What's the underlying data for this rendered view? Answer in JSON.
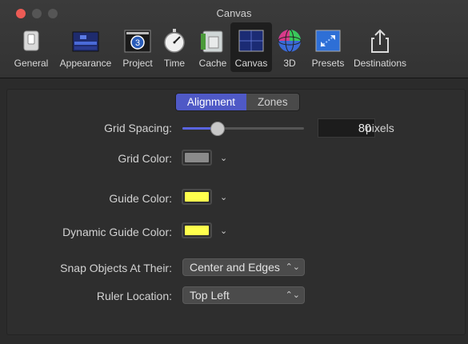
{
  "window": {
    "title": "Canvas"
  },
  "toolbar": {
    "items": [
      {
        "label": "General",
        "icon": "switch-icon"
      },
      {
        "label": "Appearance",
        "icon": "appearance-icon"
      },
      {
        "label": "Project",
        "icon": "project-icon"
      },
      {
        "label": "Time",
        "icon": "stopwatch-icon"
      },
      {
        "label": "Cache",
        "icon": "cache-icon"
      },
      {
        "label": "Canvas",
        "icon": "canvas-icon"
      },
      {
        "label": "3D",
        "icon": "sphere-icon"
      },
      {
        "label": "Presets",
        "icon": "presets-icon"
      },
      {
        "label": "Destinations",
        "icon": "share-icon"
      }
    ],
    "selected": "Canvas"
  },
  "segmented": {
    "alignment_label": "Alignment",
    "zones_label": "Zones",
    "active": "Alignment"
  },
  "grid_spacing": {
    "label": "Grid Spacing:",
    "value": "80",
    "unit": "pixels",
    "slider_fraction": 0.28
  },
  "grid_color": {
    "label": "Grid Color:",
    "color": "#8a8a8a"
  },
  "guide_color": {
    "label": "Guide Color:",
    "color": "#ffff4d"
  },
  "dynamic_guide_color": {
    "label": "Dynamic Guide Color:",
    "color": "#ffff4d"
  },
  "snap_objects": {
    "label": "Snap Objects At Their:",
    "value": "Center and Edges"
  },
  "ruler_location": {
    "label": "Ruler Location:",
    "value": "Top Left"
  },
  "colors": {
    "accent": "#4f59c6",
    "slider_fill": "#5964e0"
  }
}
